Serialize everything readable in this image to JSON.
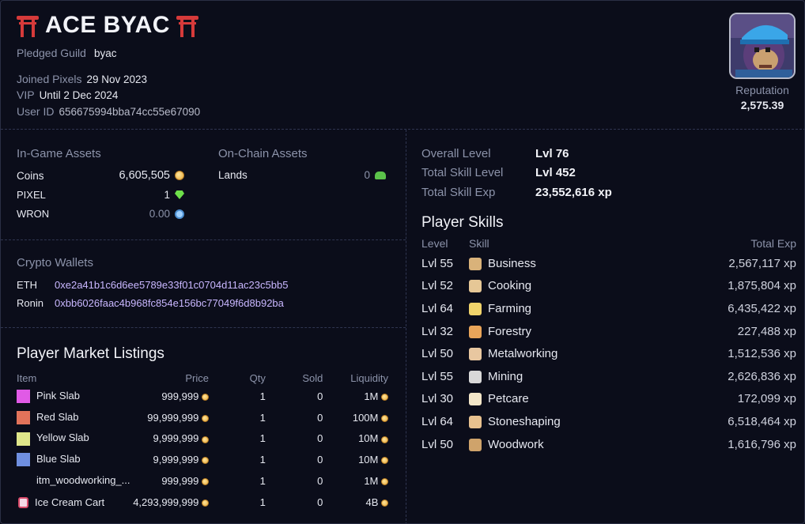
{
  "profile": {
    "name": "ACE BYAC",
    "pledged_guild_label": "Pledged Guild",
    "pledged_guild": "byac",
    "joined_label": "Joined Pixels",
    "joined": "29 Nov 2023",
    "vip_label": "VIP",
    "vip": "Until 2 Dec 2024",
    "user_id_label": "User ID",
    "user_id": "656675994bba74cc55e67090",
    "reputation_label": "Reputation",
    "reputation": "2,575.39"
  },
  "assets": {
    "ingame_title": "In-Game Assets",
    "onchain_title": "On-Chain Assets",
    "coins_label": "Coins",
    "coins": "6,605,505",
    "pixel_label": "PIXEL",
    "pixel": "1",
    "wron_label": "WRON",
    "wron": "0.00",
    "lands_label": "Lands",
    "lands": "0"
  },
  "wallets": {
    "title": "Crypto Wallets",
    "eth_label": "ETH",
    "eth": "0xe2a41b1c6d6ee5789e33f01c0704d11ac23c5bb5",
    "ronin_label": "Ronin",
    "ronin": "0xbb6026faac4b968fc854e156bc77049f6d8b92ba"
  },
  "market": {
    "title": "Player Market Listings",
    "headers": {
      "item": "Item",
      "price": "Price",
      "qty": "Qty",
      "sold": "Sold",
      "liquidity": "Liquidity"
    },
    "rows": [
      {
        "item": "Pink Slab",
        "price": "999,999",
        "qty": "1",
        "sold": "0",
        "liquidity": "1M",
        "color": "#e05ae6"
      },
      {
        "item": "Red Slab",
        "price": "99,999,999",
        "qty": "1",
        "sold": "0",
        "liquidity": "100M",
        "color": "#e2735a"
      },
      {
        "item": "Yellow Slab",
        "price": "9,999,999",
        "qty": "1",
        "sold": "0",
        "liquidity": "10M",
        "color": "#dfe68a"
      },
      {
        "item": "Blue Slab",
        "price": "9,999,999",
        "qty": "1",
        "sold": "0",
        "liquidity": "10M",
        "color": "#6f8fe0"
      },
      {
        "item": "itm_woodworking_...",
        "price": "999,999",
        "qty": "1",
        "sold": "0",
        "liquidity": "1M",
        "color": ""
      },
      {
        "item": "Ice Cream Cart",
        "price": "4,293,999,999",
        "qty": "1",
        "sold": "0",
        "liquidity": "4B",
        "color": "icon"
      }
    ]
  },
  "levels": {
    "overall_label": "Overall Level",
    "overall": "Lvl 76",
    "total_skill_label": "Total Skill Level",
    "total_skill": "Lvl 452",
    "total_exp_label": "Total Skill Exp",
    "total_exp": "23,552,616 xp"
  },
  "skills": {
    "title": "Player Skills",
    "headers": {
      "level": "Level",
      "skill": "Skill",
      "exp": "Total Exp"
    },
    "rows": [
      {
        "level": "Lvl 55",
        "skill": "Business",
        "exp": "2,567,117 xp",
        "icon": "business-icon",
        "color": "#d9b27a"
      },
      {
        "level": "Lvl 52",
        "skill": "Cooking",
        "exp": "1,875,804 xp",
        "icon": "cooking-icon",
        "color": "#e6c796"
      },
      {
        "level": "Lvl 64",
        "skill": "Farming",
        "exp": "6,435,422 xp",
        "icon": "farming-icon",
        "color": "#f0d36b"
      },
      {
        "level": "Lvl 32",
        "skill": "Forestry",
        "exp": "227,488 xp",
        "icon": "forestry-icon",
        "color": "#e9a55a"
      },
      {
        "level": "Lvl 50",
        "skill": "Metalworking",
        "exp": "1,512,536 xp",
        "icon": "metalworking-icon",
        "color": "#e8c7a0"
      },
      {
        "level": "Lvl 55",
        "skill": "Mining",
        "exp": "2,626,836 xp",
        "icon": "mining-icon",
        "color": "#d8d8d8"
      },
      {
        "level": "Lvl 30",
        "skill": "Petcare",
        "exp": "172,099 xp",
        "icon": "petcare-icon",
        "color": "#f3e6c8"
      },
      {
        "level": "Lvl 64",
        "skill": "Stoneshaping",
        "exp": "6,518,464 xp",
        "icon": "stoneshaping-icon",
        "color": "#e7c18f"
      },
      {
        "level": "Lvl 50",
        "skill": "Woodwork",
        "exp": "1,616,796 xp",
        "icon": "woodwork-icon",
        "color": "#cfa36b"
      }
    ]
  }
}
